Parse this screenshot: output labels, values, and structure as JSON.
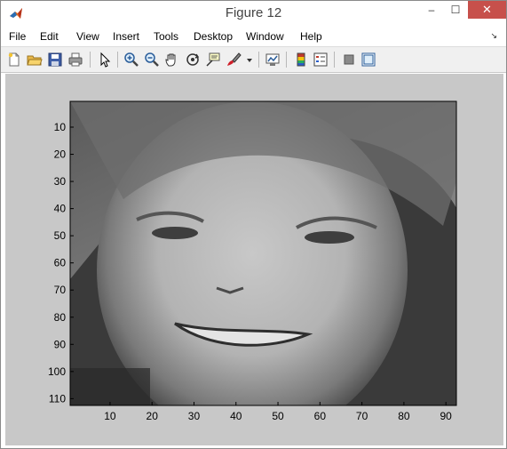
{
  "window": {
    "title": "Figure 12",
    "minimize_glyph": "–",
    "maximize_glyph": "☐",
    "close_glyph": "✕"
  },
  "menu": {
    "items": [
      {
        "label": "File"
      },
      {
        "label": "Edit"
      },
      {
        "label": "View"
      },
      {
        "label": "Insert"
      },
      {
        "label": "Tools"
      },
      {
        "label": "Desktop"
      },
      {
        "label": "Window"
      },
      {
        "label": "Help"
      }
    ],
    "overflow_glyph": "↘"
  },
  "toolbar": {
    "buttons": [
      {
        "icon": "new-figure-icon"
      },
      {
        "icon": "open-file-icon"
      },
      {
        "icon": "save-icon"
      },
      {
        "icon": "print-icon"
      },
      {
        "icon": "edit-plot-arrow-icon"
      },
      {
        "icon": "zoom-in-icon"
      },
      {
        "icon": "zoom-out-icon"
      },
      {
        "icon": "pan-hand-icon"
      },
      {
        "icon": "rotate-3d-icon"
      },
      {
        "icon": "data-cursor-icon"
      },
      {
        "icon": "brush-icon"
      },
      {
        "icon": "brush-dropdown-icon"
      },
      {
        "icon": "link-plot-icon"
      },
      {
        "icon": "colorbar-icon"
      },
      {
        "icon": "legend-icon"
      },
      {
        "icon": "hide-plot-tools-icon"
      },
      {
        "icon": "show-plot-tools-icon"
      }
    ]
  },
  "chart_data": {
    "type": "heatmap",
    "title": "",
    "xlabel": "",
    "ylabel": "",
    "colormap": "gray",
    "image_size": [
      112,
      92
    ],
    "xlim": [
      0.5,
      92.5
    ],
    "ylim": [
      0.5,
      112.5
    ],
    "y_reversed": true,
    "xticks": [
      10,
      20,
      30,
      40,
      50,
      60,
      70,
      80,
      90
    ],
    "yticks": [
      10,
      20,
      30,
      40,
      50,
      60,
      70,
      80,
      90,
      100,
      110
    ],
    "xtick_labels": [
      "10",
      "20",
      "30",
      "40",
      "50",
      "60",
      "70",
      "80",
      "90"
    ],
    "ytick_labels": [
      "10",
      "20",
      "30",
      "40",
      "50",
      "60",
      "70",
      "80",
      "90",
      "100",
      "110"
    ]
  },
  "colors": {
    "figure_background": "#c8c8c8",
    "close_button": "#c7504b"
  }
}
